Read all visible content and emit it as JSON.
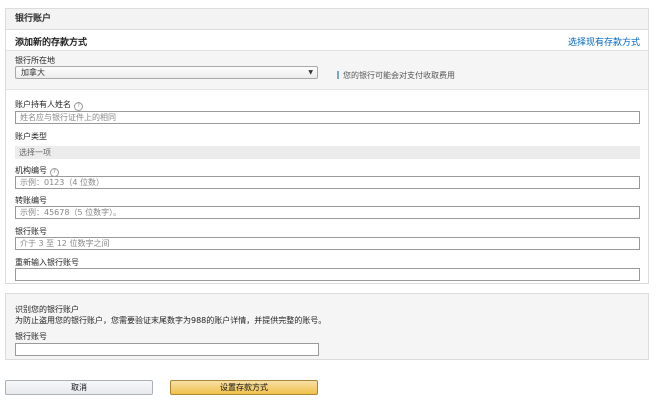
{
  "panel": {
    "title": "银行账户"
  },
  "add_method": {
    "title": "添加新的存款方式",
    "choose_existing": "选择现有存款方式"
  },
  "country": {
    "label": "银行所在地",
    "value": "加拿大",
    "fee_note": "您的银行可能会对支付收取费用"
  },
  "fields": {
    "holder_name": {
      "label": "账户持有人姓名",
      "placeholder": "姓名应与银行证件上的相同"
    },
    "account_type": {
      "label": "账户类型",
      "value": "选择一项"
    },
    "institution": {
      "label": "机构编号",
      "placeholder": "示例：0123（4 位数）"
    },
    "transit": {
      "label": "转账编号",
      "placeholder": "示例：45678（5 位数字）。"
    },
    "account_number": {
      "label": "银行账号",
      "placeholder": "介于 3 至 12 位数字之间"
    },
    "account_number_confirm": {
      "label": "重新输入银行账号",
      "placeholder": ""
    }
  },
  "verify": {
    "title": "识别您的银行账户",
    "description": "为防止盗用您的银行账户，您需要验证末尾数字为988的账户详情，并提供完整的账号。",
    "account_label": "银行账号"
  },
  "buttons": {
    "cancel": "取消",
    "submit": "设置存款方式"
  },
  "colors": {
    "link": "#0066c0",
    "submit_button": "#f0c14b"
  }
}
